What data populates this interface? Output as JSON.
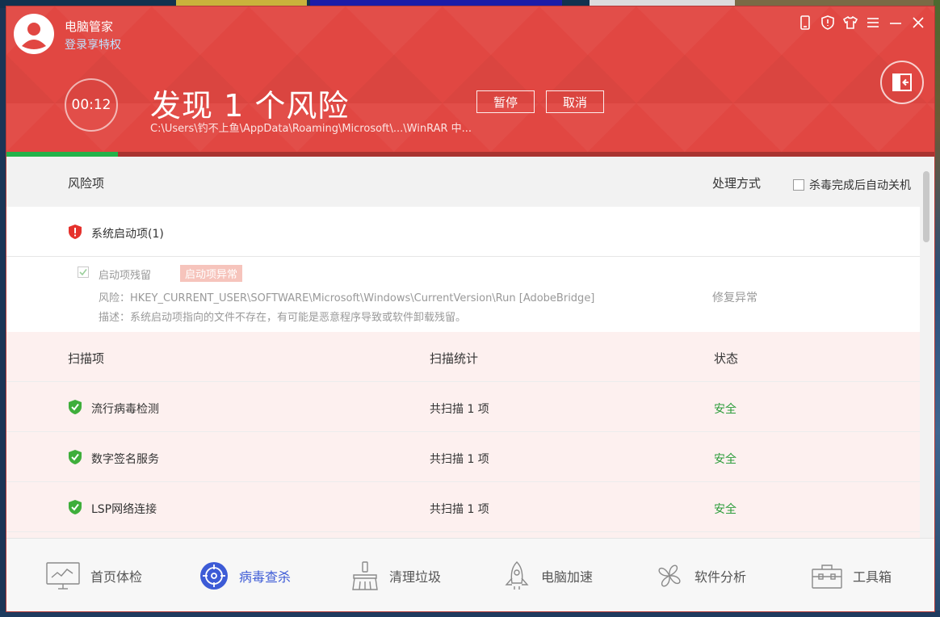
{
  "app": {
    "name": "电脑管家",
    "login_text": "登录享特权"
  },
  "scan": {
    "timer": "00:12",
    "headline": "发现 1 个风险",
    "current_path": "C:\\Users\\钓不上鱼\\AppData\\Roaming\\Microsoft\\...\\WinRAR 中...",
    "pause_label": "暂停",
    "cancel_label": "取消",
    "progress_percent": 12
  },
  "risk_table": {
    "header_item": "风险项",
    "header_action": "处理方式",
    "auto_shutdown_label": "杀毒完成后自动关机",
    "auto_shutdown_checked": false,
    "group": {
      "label": "系统启动项(1)"
    },
    "item": {
      "checked": true,
      "title": "启动项残留",
      "tag": "启动项异常",
      "risk_line": "风险：HKEY_CURRENT_USER\\SOFTWARE\\Microsoft\\Windows\\CurrentVersion\\Run [AdobeBridge]",
      "desc_line": "描述：系统启动项指向的文件不存在，有可能是恶意程序导致或软件卸载残留。",
      "action": "修复异常"
    }
  },
  "scan_table": {
    "headers": [
      "扫描项",
      "扫描统计",
      "状态"
    ],
    "rows": [
      {
        "name": "流行病毒检测",
        "stat": "共扫描 1 项",
        "status": "安全"
      },
      {
        "name": "数字签名服务",
        "stat": "共扫描 1 项",
        "status": "安全"
      },
      {
        "name": "LSP网络连接",
        "stat": "共扫描 1 项",
        "status": "安全"
      }
    ]
  },
  "nav": {
    "items": [
      {
        "label": "首页体检",
        "icon": "monitor-icon"
      },
      {
        "label": "病毒查杀",
        "icon": "virus-scan-icon",
        "active": true
      },
      {
        "label": "清理垃圾",
        "icon": "broom-icon"
      },
      {
        "label": "电脑加速",
        "icon": "rocket-icon"
      },
      {
        "label": "软件分析",
        "icon": "software-analysis-icon"
      },
      {
        "label": "工具箱",
        "icon": "toolbox-icon"
      }
    ]
  },
  "colors": {
    "header_red": "#e14742",
    "progress_green": "#23b24b",
    "safe_green": "#2b9c3a",
    "nav_active": "#3d5bd6"
  }
}
